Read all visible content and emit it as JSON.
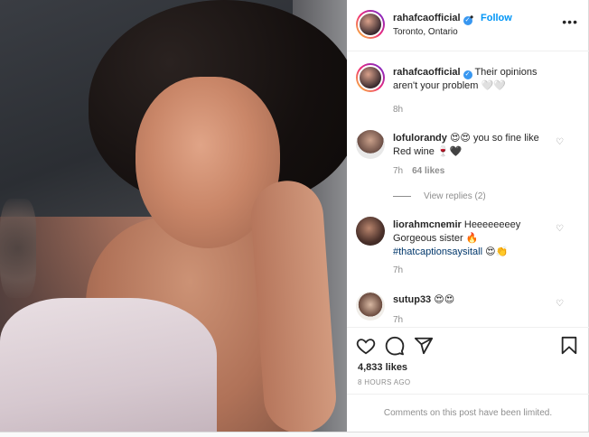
{
  "post": {
    "username": "rahafcaofficial",
    "follow_label": "Follow",
    "location": "Toronto, Ontario",
    "caption_text": "Their opinions aren't your problem 🤍🤍",
    "caption_time": "8h"
  },
  "comments": [
    {
      "username": "lofulorandy",
      "text": "😍😍 you so fine like Red wine 🍷🖤",
      "time": "7h",
      "likes": "64 likes",
      "view_replies": "View replies (2)"
    },
    {
      "username": "liorahmcnemir",
      "text": "Heeeeeeeey Gorgeous sister 🔥",
      "hashtag": "#thatcaptionsaysitall",
      "hashtag_tail": " 😍👏",
      "time": "7h"
    },
    {
      "username": "sutup33",
      "text": "😍😍",
      "time": "7h"
    }
  ],
  "actions": {
    "likes": "4,833 likes",
    "time_ago": "8 HOURS AGO",
    "limited_notice": "Comments on this post have been limited."
  },
  "icons": {
    "heart": "heart-icon",
    "comment": "comment-icon",
    "share": "share-icon",
    "save": "bookmark-icon",
    "more": "more-options-icon",
    "verified": "verified-badge-icon"
  },
  "colors": {
    "link_blue": "#0095f6",
    "verified_blue": "#3897f0",
    "hashtag_blue": "#00376b",
    "muted": "#8e8e8e"
  }
}
